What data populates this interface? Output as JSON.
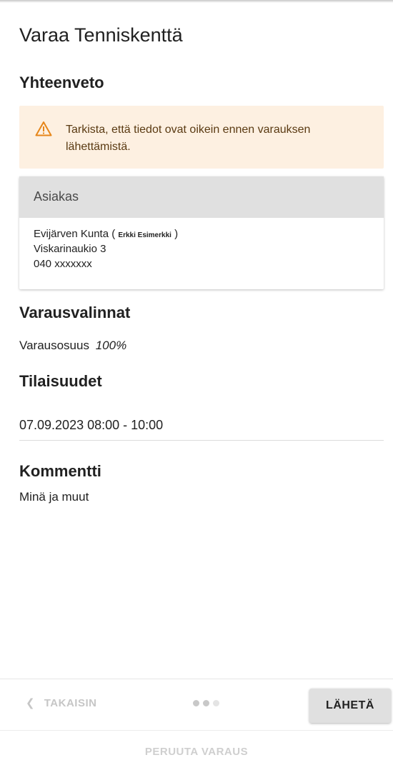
{
  "page": {
    "title": "Varaa Tenniskenttä"
  },
  "summary": {
    "heading": "Yhteenveto",
    "warning_text": "Tarkista, että tiedot ovat oikein ennen varauksen lähettämistä.",
    "warning_icon": "warning-triangle-icon",
    "warning_color": "#e6861a",
    "warning_bg": "#fdf0e1"
  },
  "customer": {
    "header": "Asiakas",
    "organization": "Evijärven Kunta",
    "contact_prefix": "(",
    "contact_name": "Erkki Esimerkki",
    "contact_suffix": ")",
    "address": "Viskarinaukio 3",
    "phone": "040 xxxxxxx"
  },
  "reservation_options": {
    "heading": "Varausvalinnat",
    "share_label": "Varausosuus",
    "share_value": "100%"
  },
  "occurrences": {
    "heading": "Tilaisuudet",
    "items": [
      "07.09.2023 08:00 - 10:00"
    ]
  },
  "comment": {
    "heading": "Kommentti",
    "text": "Minä ja muut"
  },
  "footer": {
    "back_label": "TAKAISIN",
    "back_icon": "chevron-left-icon",
    "send_label": "LÄHETÄ",
    "cancel_label": "PERUUTA VARAUS",
    "steps": {
      "total": 3,
      "active": 2,
      "colors": [
        "#c8c8c8",
        "#c8c8c8",
        "#e4e4e4"
      ]
    }
  }
}
